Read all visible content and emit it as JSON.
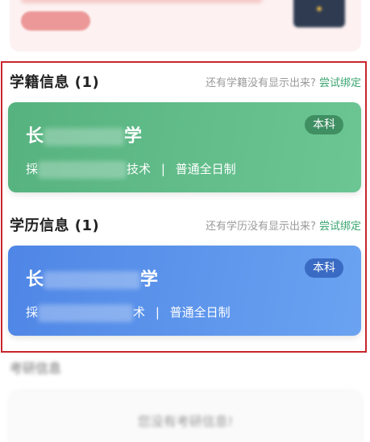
{
  "student_status": {
    "title": "学籍信息 (1)",
    "hint": "还有学籍没有显示出来?",
    "link": "尝试绑定",
    "school_prefix": "长",
    "school_suffix": "学",
    "major_prefix": "採",
    "major_suffix": "技术",
    "mode": "普通全日制",
    "separator": "|",
    "level": "本科"
  },
  "education": {
    "title": "学历信息 (1)",
    "hint": "还有学历没有显示出来?",
    "link": "尝试绑定",
    "school_prefix": "长",
    "school_suffix": "学",
    "major_prefix": "採",
    "major_suffix": "术",
    "mode": "普通全日制",
    "separator": "|",
    "level": "本科"
  },
  "bottom": {
    "title": "考研信息",
    "empty_text": "您没有考研信息!"
  },
  "colors": {
    "accent_green": "#3aa570",
    "card_green": "#56b27f",
    "card_blue": "#4f86e6",
    "highlight": "#c8262c"
  }
}
